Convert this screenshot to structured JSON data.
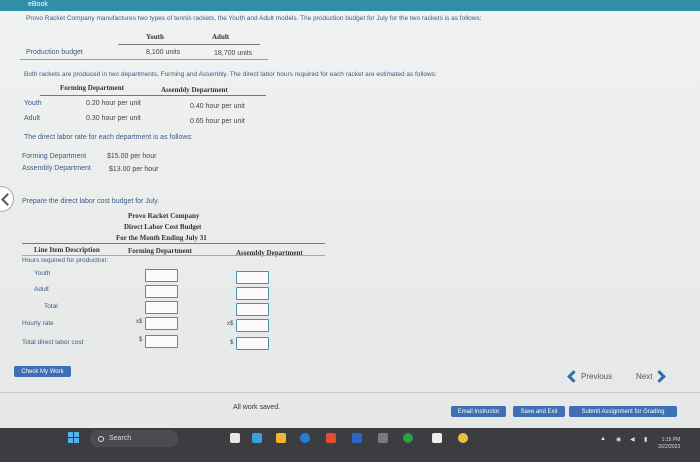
{
  "ebook": {
    "label": "eBook"
  },
  "problem": {
    "intro": "Provo Racket Company manufactures two types of tennis rackets, the Youth and Adult models. The production budget for July for the two rackets is as follows:",
    "budget_headers": {
      "youth": "Youth",
      "adult": "Adult"
    },
    "budget_row": {
      "label": "Production budget",
      "youth": "8,100 units",
      "adult": "18,700 units"
    },
    "departments_text": "Both rackets are produced in two departments, Forming and Assembly. The direct labor hours required for each racket are estimated as follows:",
    "hours_headers": {
      "forming": "Forming Department",
      "assembly": "Assembly Department"
    },
    "hours_rows": [
      {
        "label": "Youth",
        "forming": "0.20 hour per unit",
        "assembly": "0.40 hour per unit"
      },
      {
        "label": "Adult",
        "forming": "0.30 hour per unit",
        "assembly": "0.65 hour per unit"
      }
    ],
    "rate_text": "The direct labor rate for each department is as follows:",
    "rates": [
      {
        "label": "Forming Department",
        "value": "$15.00 per hour"
      },
      {
        "label": "Assembly Department",
        "value": "$13.00 per hour"
      }
    ]
  },
  "task": {
    "prompt": "Prepare the direct labor cost budget for July.",
    "company": "Provo Racket Company",
    "title": "Direct Labor Cost Budget",
    "period": "For the Month Ending July 31",
    "columns": {
      "line_item": "Line Item Description",
      "forming": "Forming Department",
      "assembly": "Assembly Department"
    },
    "rows": {
      "hours_required": "Hours required for production:",
      "youth": "Youth",
      "adult": "Adult",
      "total": "Total",
      "hourly_rate": "Hourly rate",
      "total_cost": "Total direct labor cost"
    },
    "symbols": {
      "times_dollar": "x$",
      "dollar": "$"
    }
  },
  "nav": {
    "check_my_work": "Check My Work",
    "previous": "Previous",
    "next": "Next"
  },
  "footer": {
    "status": "All work saved.",
    "email_instructor": "Email Instructor",
    "save_exit": "Save and Exit",
    "submit": "Submit Assignment for Grading"
  },
  "taskbar": {
    "search": "Search",
    "time": "1:15 PM",
    "date": "3/22/2023"
  },
  "colors": {
    "accent": "#3e6fb4",
    "input_border": "#4a8fb6",
    "header_bar": "#2f8fa8"
  }
}
